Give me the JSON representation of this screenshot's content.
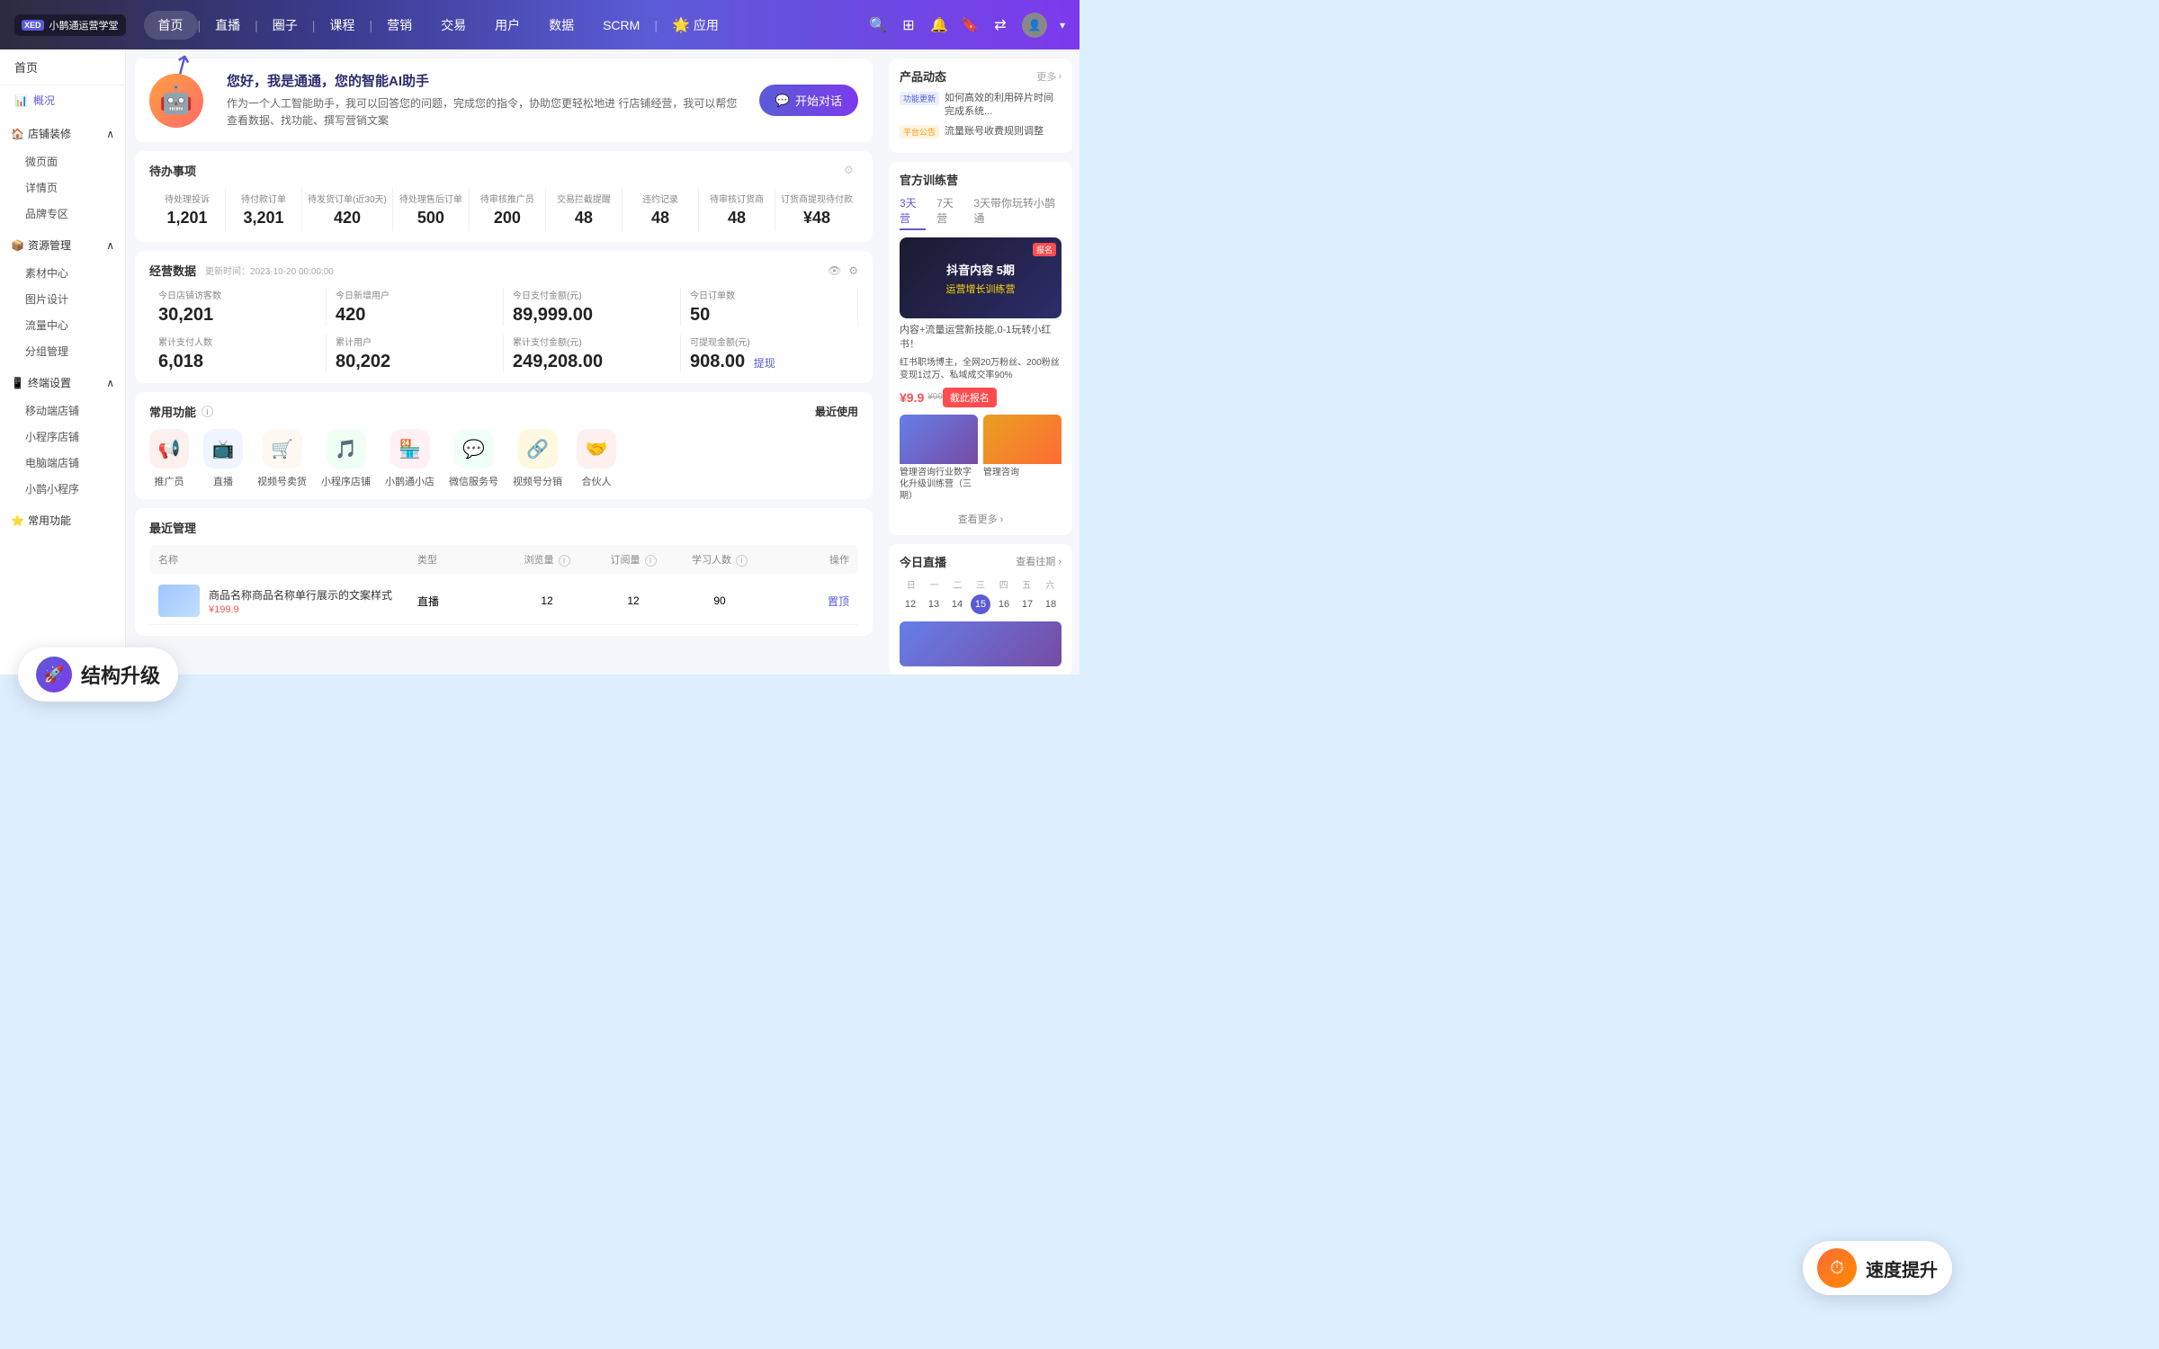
{
  "topNav": {
    "logo": {
      "badge": "XED",
      "text": "小鹊通运营学堂"
    },
    "menuItems": [
      {
        "label": "首页",
        "active": true
      },
      {
        "label": "直播"
      },
      {
        "label": "圈子"
      },
      {
        "label": "课程"
      },
      {
        "label": "营销"
      },
      {
        "label": "交易"
      },
      {
        "label": "用户"
      },
      {
        "label": "数据"
      },
      {
        "label": "SCRM"
      },
      {
        "label": "应用"
      }
    ]
  },
  "sidebar": {
    "homeLabel": "首页",
    "overviewLabel": "概况",
    "groups": [
      {
        "name": "店铺装修",
        "icon": "🏠",
        "items": [
          "微页面",
          "详情页",
          "品牌专区"
        ]
      },
      {
        "name": "资源管理",
        "icon": "📦",
        "items": [
          "素材中心",
          "图片设计",
          "流量中心",
          "分组管理"
        ]
      },
      {
        "name": "终端设置",
        "icon": "📱",
        "items": [
          "移动端店铺",
          "小程序店铺",
          "电脑端店铺",
          "小鹊小程序"
        ]
      },
      {
        "name": "常用功能",
        "icon": "⭐"
      }
    ]
  },
  "aiBanner": {
    "title": "您好，我是通通，您的智能AI助手",
    "desc": "作为一个人工智能助手，我可以回答您的问题，完成您的指令，协助您更轻松地进\n行店铺经营，我可以帮您查看数据、找功能、撰写营销文案",
    "btnLabel": "开始对话",
    "btnIcon": "💬"
  },
  "todoSection": {
    "title": "待办事项",
    "items": [
      {
        "label": "待处理投诉",
        "value": "1,201"
      },
      {
        "label": "待付款订单",
        "value": "3,201"
      },
      {
        "label": "待发货订单(近30天)",
        "value": "420"
      },
      {
        "label": "待处理售后订单",
        "value": "500"
      },
      {
        "label": "待审核推广员",
        "value": "200"
      },
      {
        "label": "交易拦截提醒",
        "value": "48"
      },
      {
        "label": "违约记录",
        "value": "48"
      },
      {
        "label": "待审核订货商",
        "value": "48"
      },
      {
        "label": "订货商提现待付款",
        "value": "¥48"
      }
    ]
  },
  "bizData": {
    "title": "经营数据",
    "updateTime": "更新时间：2023-10-20 00:00:00",
    "items": [
      {
        "label": "今日店铺访客数",
        "value": "30,201"
      },
      {
        "label": "今日新增用户",
        "value": "420"
      },
      {
        "label": "今日支付金额(元)",
        "value": "89,999.00"
      },
      {
        "label": "今日订单数",
        "value": "50"
      },
      {
        "label": "累计支付人数",
        "value": "6,018"
      },
      {
        "label": "累计用户",
        "value": "80,202"
      },
      {
        "label": "累计支付金额(元)",
        "value": "249,208.00"
      },
      {
        "label": "可提现金额(元)",
        "value": "908.00",
        "withdraw": "提现"
      }
    ]
  },
  "commonFunc": {
    "title": "常用功能",
    "recentLabel": "最近使用",
    "items": [
      {
        "label": "推广员",
        "icon": "📢",
        "bg": "#fff0f0",
        "color": "#ff4d4f"
      },
      {
        "label": "直播",
        "icon": "📺",
        "bg": "#f0f4ff",
        "color": "#5b5bd6"
      },
      {
        "label": "视频号卖货",
        "icon": "🛒",
        "bg": "#fff8f0",
        "color": "#ff8c00"
      },
      {
        "label": "小程序店铺",
        "icon": "🎵",
        "bg": "#f0fff4",
        "color": "#52c41a"
      },
      {
        "label": "小鹊通小店",
        "icon": "🏪",
        "bg": "#fff0f5",
        "color": "#ff69b4"
      },
      {
        "label": "微信服务号",
        "icon": "💬",
        "bg": "#f0fff8",
        "color": "#09b96e"
      },
      {
        "label": "视频号分销",
        "icon": "🔗",
        "bg": "#fff8e0",
        "color": "#faad14"
      },
      {
        "label": "合伙人",
        "icon": "🤝",
        "bg": "#fff0f0",
        "color": "#ff4d4f"
      }
    ]
  },
  "recentManage": {
    "title": "最近管理",
    "columns": [
      "名称",
      "类型",
      "浏览量",
      "订阅量",
      "学习人数",
      "操作"
    ],
    "rows": [
      {
        "name": "商品名称商品名称单行展示的文案样式",
        "price": "¥199.9",
        "type": "直播",
        "views": "12",
        "orders": "12",
        "students": "90",
        "action": "置顶"
      }
    ]
  },
  "rightPanel": {
    "productDynamics": {
      "title": "产品动态",
      "moreLabel": "更多",
      "items": [
        {
          "tag": "功能更新",
          "tagType": "update",
          "text": "如何高效的利用碎片时间完成系统..."
        },
        {
          "tag": "平台公告",
          "tagType": "announce",
          "text": "流量账号收费规则调整"
        }
      ]
    },
    "training": {
      "title": "官方训练营",
      "tabs": [
        "3天营",
        "7天营",
        "3天带你玩转小鹊通"
      ],
      "activeTab": 0,
      "bannerTitle": "抖音内容 5期",
      "bannerSub": "运营增长训练营",
      "badgeLabel": "报名",
      "desc": "内容+流量运营新技能,0-1玩转小红书！",
      "subdesc": "红书职场博主，全网20万粉丝、200粉丝变现1过万、私域成交率90%",
      "price": "¥9.9",
      "priceOrig": "¥99",
      "enrollBtn": "截此报名",
      "miniItems": [
        {
          "label": "管理咨询行业数字化升级训练营（三期）",
          "bg": "#667eea"
        },
        {
          "label": "管理咨询",
          "bg": "#e8a020"
        }
      ]
    },
    "todayLive": {
      "title": "今日直播",
      "historyLabel": "查看往期",
      "calDayLabels": [
        "日",
        "一",
        "二",
        "三",
        "四",
        "五",
        "六"
      ],
      "calDates": [
        "12",
        "13",
        "14",
        "15",
        "16",
        "17",
        "18"
      ],
      "todayDate": "15"
    }
  },
  "floatUpgrade": {
    "text": "结构升级"
  },
  "floatSpeed": {
    "text": "速度提升"
  }
}
